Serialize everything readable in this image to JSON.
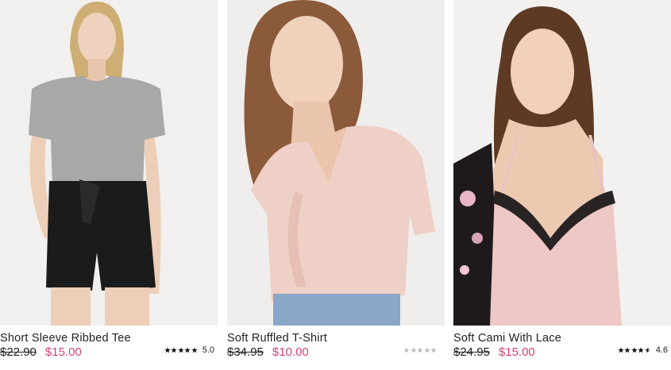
{
  "products": [
    {
      "name": "Short Sleeve Ribbed Tee",
      "original_price": "$22.90",
      "sale_price": "$15.00",
      "rating": 5.0,
      "rating_label": "5.0",
      "image_icon": "model-photo-grey-tee"
    },
    {
      "name": "Soft Ruffled T-Shirt",
      "original_price": "$34.95",
      "sale_price": "$10.00",
      "rating": 0,
      "rating_label": "",
      "image_icon": "model-photo-pink-ruffled-tee"
    },
    {
      "name": "Soft Cami With Lace",
      "original_price": "$24.95",
      "sale_price": "$15.00",
      "rating": 4.6,
      "rating_label": "4.6",
      "image_icon": "model-photo-pink-lace-cami"
    }
  ],
  "colors": {
    "sale_price": "#d1437a",
    "star_filled": "#111111",
    "star_empty": "#bbbbbb"
  }
}
